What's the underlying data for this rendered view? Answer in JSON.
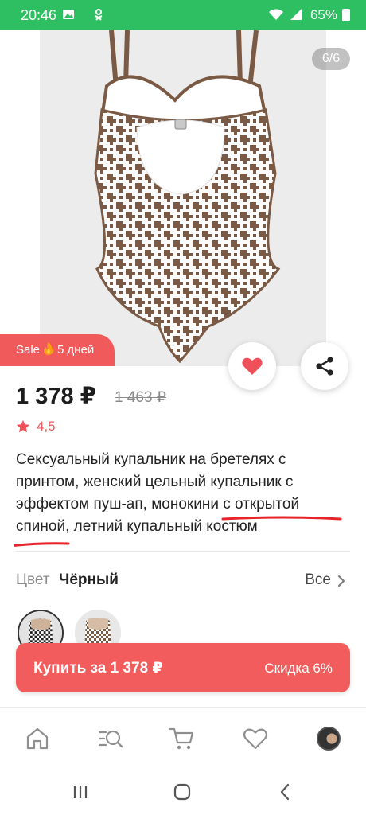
{
  "status_bar": {
    "time": "20:46",
    "battery": "65%"
  },
  "gallery": {
    "counter": "6/6"
  },
  "sale_badge": {
    "label": "Sale",
    "days": "5 дней"
  },
  "product": {
    "price": "1 378 ₽",
    "old_price": "1 463 ₽",
    "rating": "4,5",
    "title": "Сексуальный купальник на бретелях с принтом, женский цельный купальник с эффектом пуш-ап, монокини с открытой спиной, летний купальный костюм"
  },
  "color": {
    "label": "Цвет",
    "value": "Чёрный",
    "all_label": "Все"
  },
  "buy": {
    "label": "Купить за 1 378 ₽",
    "discount": "Скидка 6%"
  },
  "nav": {
    "items": [
      "home-icon",
      "catalog-search-icon",
      "cart-icon",
      "favorites-icon",
      "profile-avatar"
    ]
  },
  "colors": {
    "status_bar": "#2fbf63",
    "accent": "#f25c5c",
    "underline": "#e8242a"
  }
}
